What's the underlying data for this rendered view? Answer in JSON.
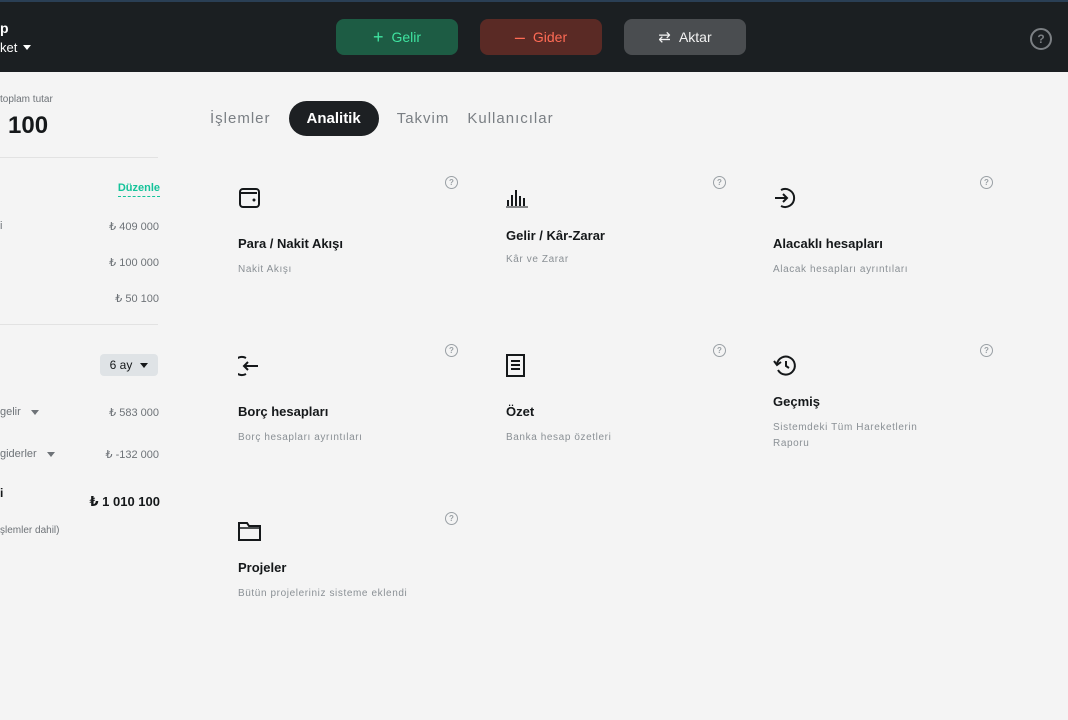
{
  "header": {
    "brand_name": "p",
    "brand_sub": "ket",
    "income_button": "Gelir",
    "expense_button": "Gider",
    "transfer_button": "Aktar",
    "income_symbol": "+",
    "expense_symbol": "–",
    "transfer_symbol": "⇄",
    "help_symbol": "?"
  },
  "sidebar": {
    "total_label": "toplam tutar",
    "total_value": "100",
    "edit_label": "Düzenle",
    "accounts": [
      {
        "name": "i",
        "amount": "₺ 409 000"
      },
      {
        "name": "",
        "amount": "₺ 100 000"
      },
      {
        "name": "",
        "amount": "₺ 50 100"
      }
    ],
    "period": "6 ay",
    "income_label": "gelir",
    "income_amount": "₺ 583 000",
    "expense_label": "giderler",
    "expense_amount": "₺ -132 000",
    "balance_title": "i",
    "balance_amount": "₺ 1 010 100",
    "balance_note": "şlemler dahil)"
  },
  "tabs": [
    "İşlemler",
    "Analitik",
    "Takvim",
    "Kullanıcılar"
  ],
  "active_tab": "Analitik",
  "cards": [
    {
      "icon": "wallet-icon",
      "title": "Para / Nakit Akışı",
      "desc": "Nakit Akışı"
    },
    {
      "icon": "bar-chart-icon",
      "title": "Gelir / Kâr-Zarar",
      "desc": "Kâr ve Zarar"
    },
    {
      "icon": "login-arrow-icon",
      "title": "Alacaklı hesapları",
      "desc": "Alacak hesapları ayrıntıları"
    },
    {
      "icon": "logout-arrow-icon",
      "title": "Borç hesapları",
      "desc": "Borç hesapları ayrıntıları"
    },
    {
      "icon": "document-icon",
      "title": "Özet",
      "desc": "Banka hesap özetleri"
    },
    {
      "icon": "history-icon",
      "title": "Geçmiş",
      "desc": "Sistemdeki Tüm Hareketlerin Raporu"
    },
    {
      "icon": "folder-icon",
      "title": "Projeler",
      "desc": "Bütün projeleriniz sisteme eklendi"
    }
  ],
  "colors": {
    "topbar": "#1b1f22",
    "income": "#3fe3a0",
    "expense": "#ff6b55",
    "accent": "#14c39a"
  }
}
